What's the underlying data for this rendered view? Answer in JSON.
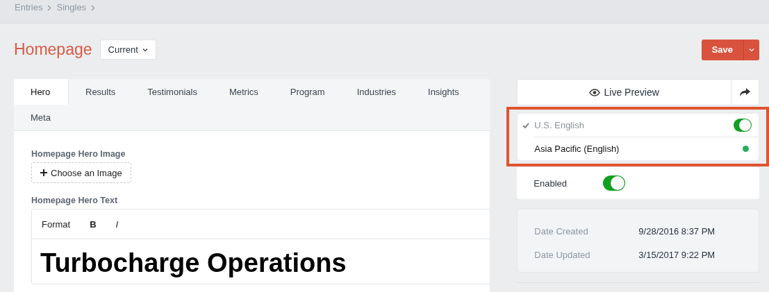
{
  "breadcrumbs": [
    {
      "label": "Entries"
    },
    {
      "label": "Singles"
    }
  ],
  "title": "Homepage",
  "revision": {
    "label": "Current"
  },
  "save_button": {
    "label": "Save"
  },
  "tabs": [
    {
      "label": "Hero",
      "selected": true
    },
    {
      "label": "Results",
      "selected": false
    },
    {
      "label": "Testimonials",
      "selected": false
    },
    {
      "label": "Metrics",
      "selected": false
    },
    {
      "label": "Program",
      "selected": false
    },
    {
      "label": "Industries",
      "selected": false
    },
    {
      "label": "Insights",
      "selected": false
    },
    {
      "label": "Meta",
      "selected": false
    }
  ],
  "fields": [
    {
      "kind": "image",
      "label": "Homepage Hero Image",
      "button": "Choose an Image"
    },
    {
      "kind": "richtext",
      "label": "Homepage Hero Text",
      "toolbar": [
        "Format",
        "B",
        "I"
      ],
      "heading": "Turbocharge Operations"
    }
  ],
  "live_preview": {
    "label": "Live Preview"
  },
  "sites": [
    {
      "name": "U.S. English",
      "selected": true,
      "kind": "toggle",
      "on": true
    },
    {
      "name": "Asia Pacific (English)",
      "selected": false,
      "kind": "dot",
      "color": "#27ae60"
    }
  ],
  "enabled": {
    "label": "Enabled",
    "on": true
  },
  "meta": [
    {
      "label": "Date Created",
      "value": "9/28/2016 8:37 PM"
    },
    {
      "label": "Date Updated",
      "value": "3/15/2017 9:22 PM"
    }
  ]
}
